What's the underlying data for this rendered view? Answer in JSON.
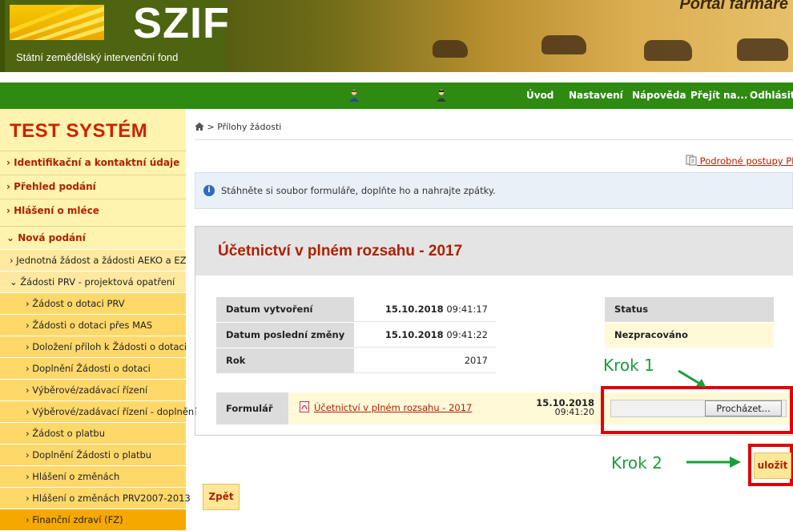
{
  "header": {
    "logo_text": "SZIF",
    "logo_subtitle": "Státní zemědělský intervenční fond",
    "portal_title": "Portál farmáře"
  },
  "topnav": {
    "icons": [
      "user-icon",
      "user-icon"
    ],
    "items": [
      "Úvod",
      "Nastavení",
      "Nápověda",
      "Přejít na...",
      "Odhlásit"
    ]
  },
  "sidebar": {
    "title": "TEST SYSTÉM",
    "items": [
      {
        "label": "Identifikační a kontaktní údaje",
        "expanded": false
      },
      {
        "label": "Přehled podání",
        "expanded": false
      },
      {
        "label": "Hlášení o mléce",
        "expanded": false
      },
      {
        "label": "Nová podání",
        "expanded": true
      }
    ],
    "sub": [
      {
        "label": "Jednotná žádost a žádosti AEKO a EZ",
        "level": 2,
        "expanded": false
      },
      {
        "label": "Žádosti PRV - projektová opatření",
        "level": 2,
        "expanded": true
      },
      {
        "label": "Žádost o dotaci PRV",
        "level": 3
      },
      {
        "label": "Žádosti o dotaci přes MAS",
        "level": 3
      },
      {
        "label": "Doložení příloh k Žádosti o dotaci",
        "level": 3
      },
      {
        "label": "Doplnění Žádosti o dotaci",
        "level": 3
      },
      {
        "label": "Výběrové/zadávací řízení",
        "level": 3
      },
      {
        "label": "Výběrové/zadávací řízení - doplnění",
        "level": 3
      },
      {
        "label": "Žádost o platbu",
        "level": 3
      },
      {
        "label": "Doplnění Žádosti o platbu",
        "level": 3
      },
      {
        "label": "Hlášení o změnách",
        "level": 3
      },
      {
        "label": "Hlášení o změnách PRV2007-2013",
        "level": 3
      },
      {
        "label": "Finanční zdraví (FZ)",
        "level": 3,
        "active": true
      }
    ]
  },
  "breadcrumb": {
    "separator": ">",
    "current": "Přílohy žádosti"
  },
  "postupy_link": "Podrobné postupy PRV",
  "info": {
    "text": "Stáhněte si soubor formuláře, doplňte ho a nahrajte zpátky."
  },
  "panel": {
    "title": "Účetnictví v plném rozsahu - 2017",
    "rows": [
      {
        "label": "Datum vytvoření",
        "date": "15.10.2018",
        "time": "09:41:17"
      },
      {
        "label": "Datum poslední změny",
        "date": "15.10.2018",
        "time": "09:41:22"
      },
      {
        "label": "Rok",
        "date": "",
        "time": "2017"
      }
    ],
    "status_label": "Status",
    "status_value": "Nezpracováno",
    "form": {
      "label": "Formulář",
      "link": "Účetnictví v plném rozsahu - 2017",
      "date": "15.10.2018",
      "time": "09:41:20",
      "browse": "Procházet..."
    }
  },
  "annotations": {
    "krok1": "Krok 1",
    "krok2": "Krok 2"
  },
  "buttons": {
    "save": "uložit",
    "back": "Zpět"
  },
  "colors": {
    "green_nav": "#2f8a12",
    "accent_red": "#b02000",
    "highlight_red": "#e00000",
    "annotation_green": "#1a9e3a"
  }
}
